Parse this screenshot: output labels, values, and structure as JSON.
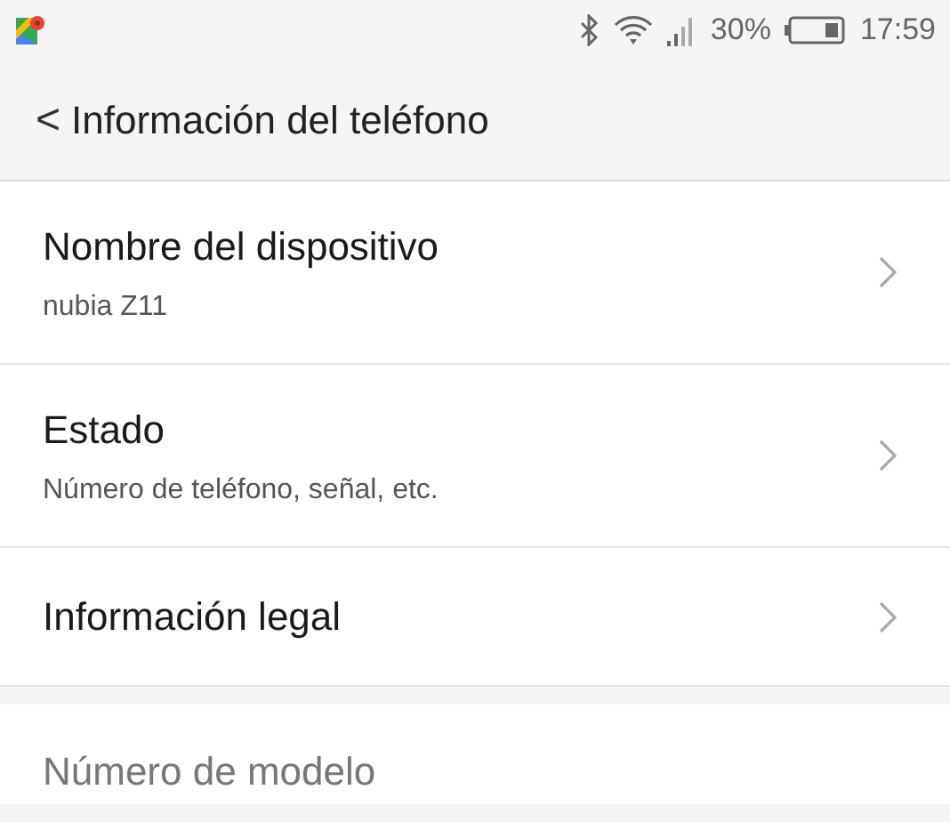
{
  "status_bar": {
    "battery_text": "30%",
    "time": "17:59"
  },
  "header": {
    "back": "<",
    "title": "Información del teléfono"
  },
  "items": [
    {
      "title": "Nombre del dispositivo",
      "subtitle": "nubia Z11"
    },
    {
      "title": "Estado",
      "subtitle": "Número de teléfono, señal, etc."
    },
    {
      "title": "Información legal"
    }
  ],
  "section_2": [
    {
      "title": "Número de modelo"
    }
  ]
}
